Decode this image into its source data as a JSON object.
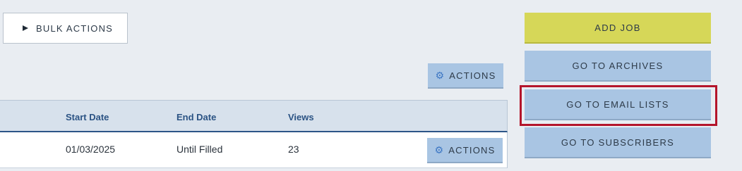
{
  "toolbar": {
    "bulk_actions_label": "BULK ACTIONS",
    "actions_label": "ACTIONS"
  },
  "table": {
    "columns": [
      "Start Date",
      "End Date",
      "Views"
    ],
    "rows": [
      {
        "start_date": "01/03/2025",
        "end_date": "Until Filled",
        "views": "23",
        "actions_label": "ACTIONS"
      }
    ]
  },
  "sidebar": {
    "add_job_label": "ADD JOB",
    "archives_label": "GO TO ARCHIVES",
    "email_lists_label": "GO TO EMAIL LISTS",
    "subscribers_label": "GO TO SUBSCRIBERS"
  },
  "icons": {
    "bulk_actions": "play-triangle-icon",
    "actions": "gear-icon"
  },
  "colors": {
    "background": "#e9edf2",
    "add_job": "#d6d758",
    "secondary_button": "#a9c5e3",
    "header_text": "#2b5384",
    "highlight": "#b4152b"
  }
}
